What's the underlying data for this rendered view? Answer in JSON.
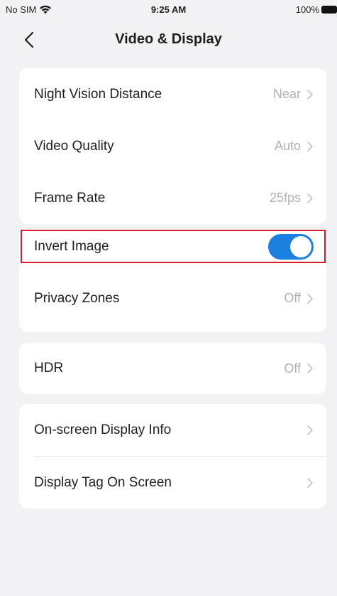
{
  "status_bar": {
    "carrier": "No SIM",
    "time": "9:25 AM",
    "battery": "100%"
  },
  "header": {
    "title": "Video & Display"
  },
  "groups": [
    {
      "rows": [
        {
          "label": "Night Vision Distance",
          "value": "Near"
        },
        {
          "label": "Video Quality",
          "value": "Auto"
        },
        {
          "label": "Frame Rate",
          "value": "25fps"
        }
      ]
    },
    {
      "rows": [
        {
          "label": "Invert Image",
          "toggle_on": true
        },
        {
          "label": "Privacy Zones",
          "value": "Off"
        }
      ]
    },
    {
      "rows": [
        {
          "label": "HDR",
          "value": "Off"
        }
      ]
    },
    {
      "rows": [
        {
          "label": "On-screen Display Info",
          "value": ""
        },
        {
          "label": "Display Tag On Screen",
          "value": ""
        }
      ]
    }
  ],
  "colors": {
    "accent": "#1b80e0",
    "highlight": "#d81b26",
    "background": "#f2f2f4",
    "value_gray": "#b1b1b6"
  },
  "icons": [
    "wifi-icon",
    "battery-icon",
    "back-chevron-icon",
    "chevron-right-icon"
  ]
}
